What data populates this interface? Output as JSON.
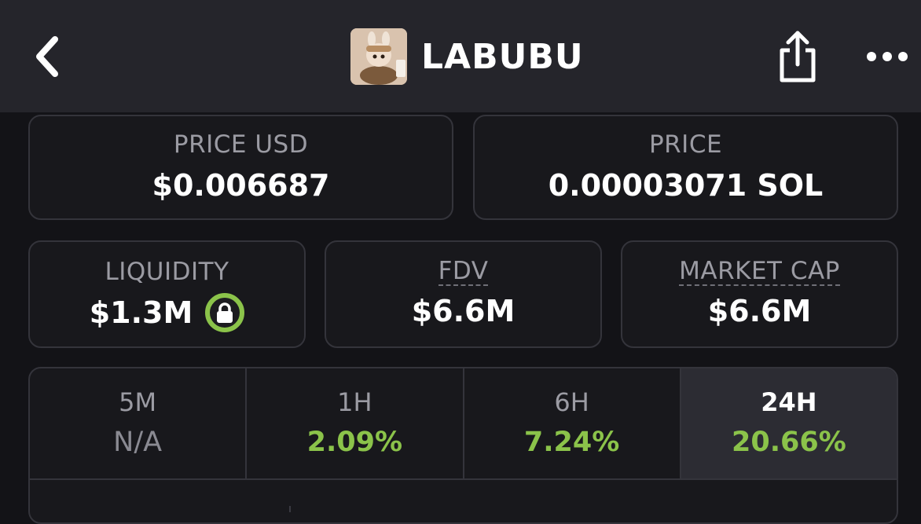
{
  "header": {
    "title": "LABUBU",
    "icons": {
      "back": "chevron-left-icon",
      "share": "share-icon",
      "more": "more-horizontal-icon"
    }
  },
  "price_usd": {
    "label": "PRICE USD",
    "value": "$0.006687"
  },
  "price_native": {
    "label": "PRICE",
    "value": "0.00003071 SOL"
  },
  "liquidity": {
    "label": "LIQUIDITY",
    "value": "$1.3M",
    "badge_icon": "lock-icon"
  },
  "fdv": {
    "label": "FDV",
    "value": "$6.6M"
  },
  "market_cap": {
    "label": "MARKET CAP",
    "value": "$6.6M"
  },
  "timeframes": [
    {
      "label": "5M",
      "value": "N/A"
    },
    {
      "label": "1H",
      "value": "2.09%"
    },
    {
      "label": "6H",
      "value": "7.24%"
    },
    {
      "label": "24H",
      "value": "20.66%"
    }
  ],
  "selected_timeframe": "24H",
  "colors": {
    "background": "#131317",
    "header": "#25252b",
    "card_border": "#34343b",
    "positive": "#8bc34a",
    "muted": "#9b9ba3"
  }
}
